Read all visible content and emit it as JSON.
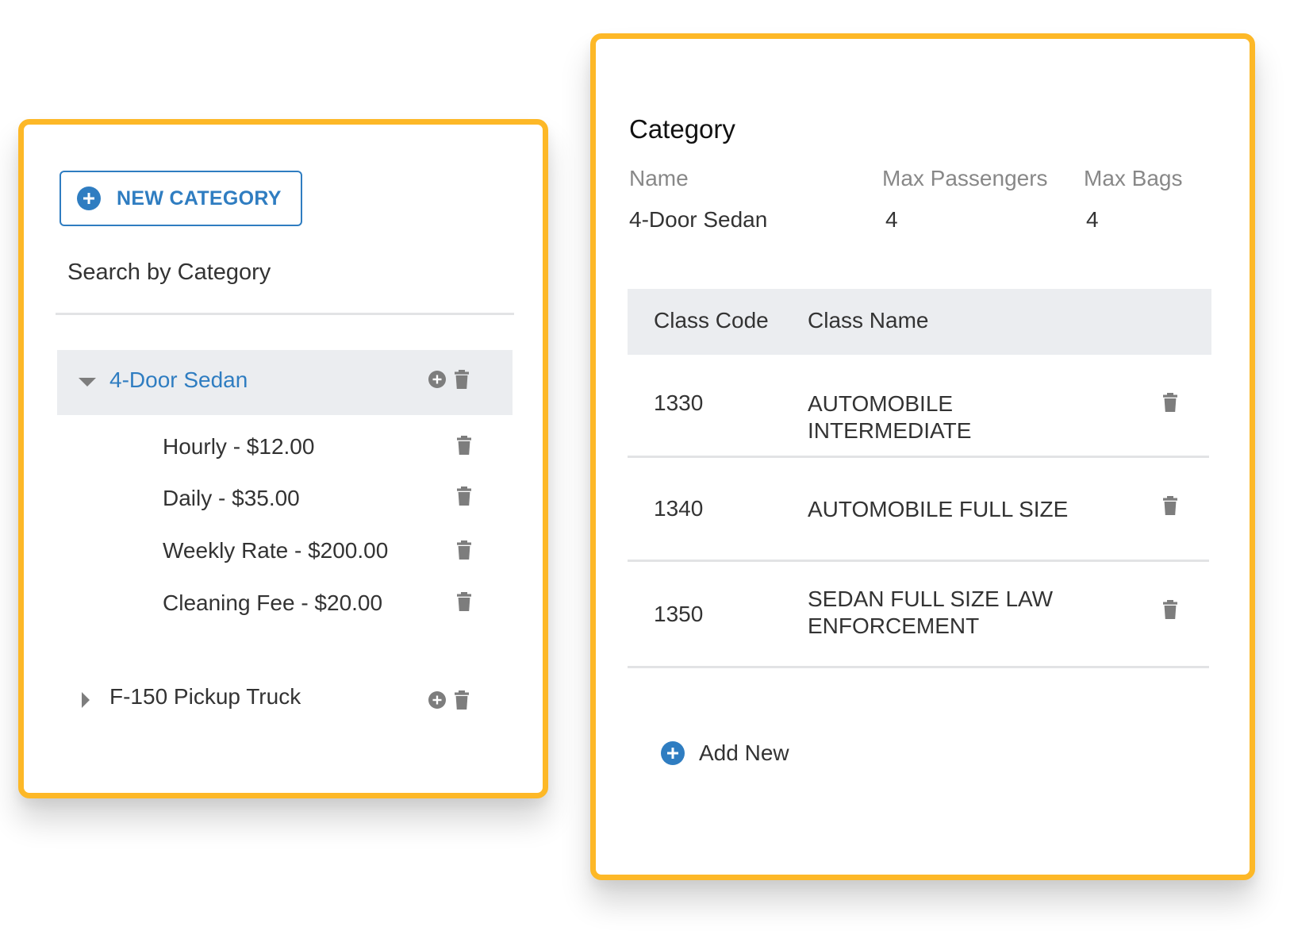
{
  "colors": {
    "accent_border": "#FDB827",
    "primary_blue": "#2F7DC1",
    "row_highlight": "#EBEDF0",
    "icon_gray": "#7D7D7D"
  },
  "categories_panel": {
    "new_category_label": "NEW CATEGORY",
    "search_label": "Search by Category",
    "categories": [
      {
        "name": "4-Door Sedan",
        "expanded": true,
        "rates": [
          {
            "label": "Hourly - $12.00"
          },
          {
            "label": "Daily - $35.00"
          },
          {
            "label": "Weekly Rate - $200.00"
          },
          {
            "label": "Cleaning Fee - $20.00"
          }
        ]
      },
      {
        "name": "F-150 Pickup Truck",
        "expanded": false,
        "rates": []
      }
    ]
  },
  "category_detail": {
    "title": "Category",
    "headers": {
      "name": "Name",
      "max_passengers": "Max Passengers",
      "max_bags": "Max Bags"
    },
    "values": {
      "name": "4-Door Sedan",
      "max_passengers": "4",
      "max_bags": "4"
    },
    "class_table": {
      "columns": [
        "Class Code",
        "Class Name"
      ],
      "rows": [
        {
          "code": "1330",
          "name": "AUTOMOBILE INTERMEDIATE"
        },
        {
          "code": "1340",
          "name": "AUTOMOBILE FULL SIZE"
        },
        {
          "code": "1350",
          "name": "SEDAN FULL SIZE LAW ENFORCEMENT"
        }
      ]
    },
    "add_new_label": "Add New"
  },
  "icons": {
    "add": "plus-circle-icon",
    "delete": "trash-icon",
    "expand": "caret-down-icon",
    "collapse": "caret-right-icon"
  }
}
